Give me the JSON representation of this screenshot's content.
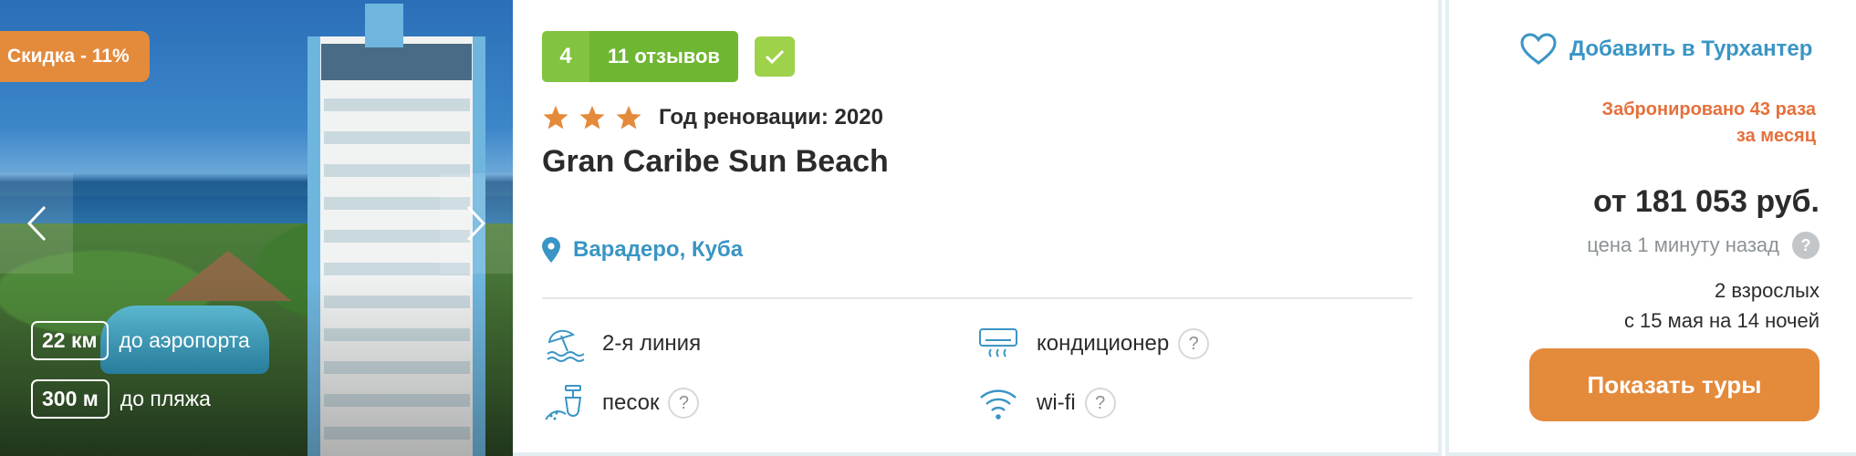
{
  "photo": {
    "discount_label": "Скидка - 11%",
    "airport_distance": "22 км",
    "airport_label": "до аэропорта",
    "beach_distance": "300 м",
    "beach_label": "до пляжа"
  },
  "rating": {
    "score": "4",
    "reviews": "11 отзывов"
  },
  "hotel": {
    "stars": 3,
    "renovation": "Год реновации: 2020",
    "name": "Gran Caribe Sun Beach",
    "location": "Варадеро, Куба"
  },
  "features": {
    "line": "2-я линия",
    "sand": "песок",
    "ac": "кондиционер",
    "wifi": "wi-fi",
    "help": "?"
  },
  "side": {
    "favorite_label": "Добавить в Турхантер",
    "booked_line1": "Забронировано 43 раза",
    "booked_line2": "за месяц",
    "price": "от 181 053 руб.",
    "price_updated": "цена 1 минуту назад",
    "help": "?",
    "guests": "2 взрослых",
    "dates": "с 15 мая на 14 ночей",
    "cta_label": "Показать туры"
  },
  "colors": {
    "accent_orange": "#e48a3b",
    "link_blue": "#3a95c5",
    "rating_green": "#82c341",
    "booked_orange": "#e5703b"
  }
}
